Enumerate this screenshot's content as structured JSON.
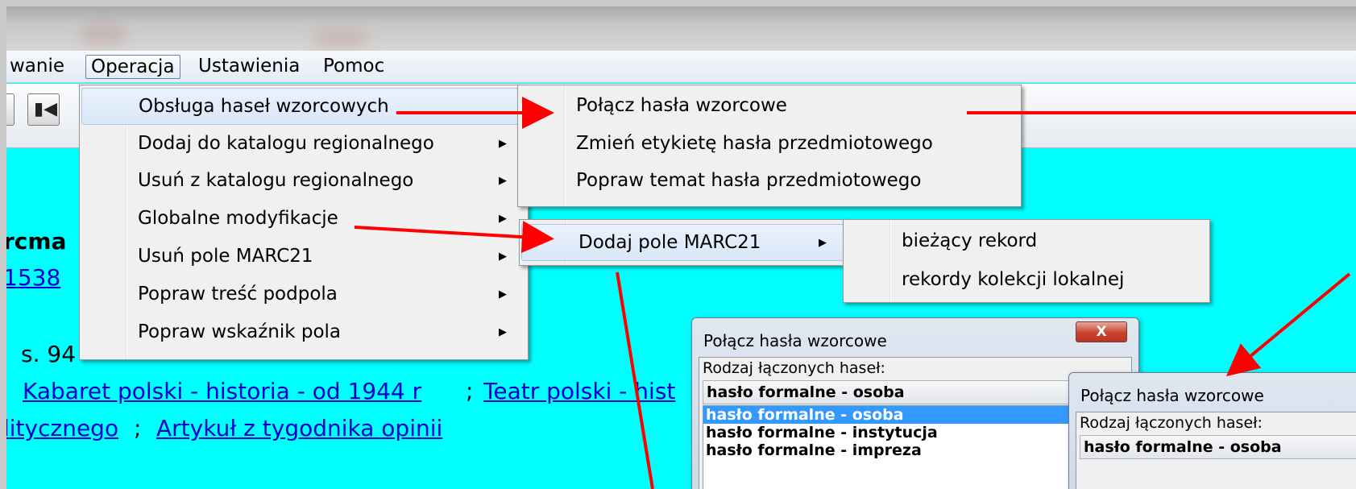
{
  "menubar": {
    "items": [
      "wanie",
      "Operacja",
      "Ustawienia",
      "Pomoc"
    ]
  },
  "toolbar": {
    "icons": [
      "button-icon",
      "last-record-icon"
    ]
  },
  "content": {
    "lines": {
      "name_fragment": "rcma",
      "link_fragment": "1538",
      "pages": "s. 94",
      "subject_link_1": "Kabaret polski - historia - od 1944 r",
      "separator_1": ";",
      "subject_link_2": "Teatr polski - hist",
      "line3_link_1": "litycznego",
      "separator_2": ";",
      "line3_link_2": "Artykuł z tygodnika opinii"
    }
  },
  "menu_operacja": {
    "items": [
      {
        "label": "Obsługa haseł wzorcowych",
        "submenu": false
      },
      {
        "label": "Dodaj do katalogu regionalnego",
        "submenu": true
      },
      {
        "label": "Usuń z katalogu regionalnego",
        "submenu": true
      },
      {
        "label": "Globalne modyfikacje",
        "submenu": true
      },
      {
        "label": "Usuń pole MARC21",
        "submenu": true
      },
      {
        "label": "Popraw treść podpola",
        "submenu": true
      },
      {
        "label": "Popraw wskaźnik pola",
        "submenu": true
      }
    ]
  },
  "submenu_hasla": {
    "items": [
      {
        "label": "Połącz hasła wzorcowe"
      },
      {
        "label": "Zmień etykietę hasła przedmiotowego"
      },
      {
        "label": "Popraw temat hasła przedmiotowego"
      }
    ]
  },
  "submenu_global": {
    "items": [
      {
        "label": "Dodaj pole MARC21",
        "submenu": true
      }
    ]
  },
  "submenu_marc": {
    "items": [
      {
        "label": "bieżący rekord"
      },
      {
        "label": "rekordy kolekcji lokalnej"
      }
    ]
  },
  "dialog1": {
    "title": "Połącz hasła wzorcowe",
    "close_label": "X",
    "field_label": "Rodzaj łączonych haseł:",
    "combo_value": "hasło formalne - osoba",
    "options": [
      "hasło formalne - osoba",
      "hasło formalne - instytucja",
      "hasło formalne - impreza"
    ]
  },
  "dialog2": {
    "title": "Połącz hasła wzorcowe",
    "field_label": "Rodzaj łączonych haseł:",
    "combo_value": "hasło formalne - osoba"
  },
  "colors": {
    "background": "#00ffff",
    "link": "#0000cc",
    "arrow": "#ff0000",
    "selection": "#3399ff"
  }
}
